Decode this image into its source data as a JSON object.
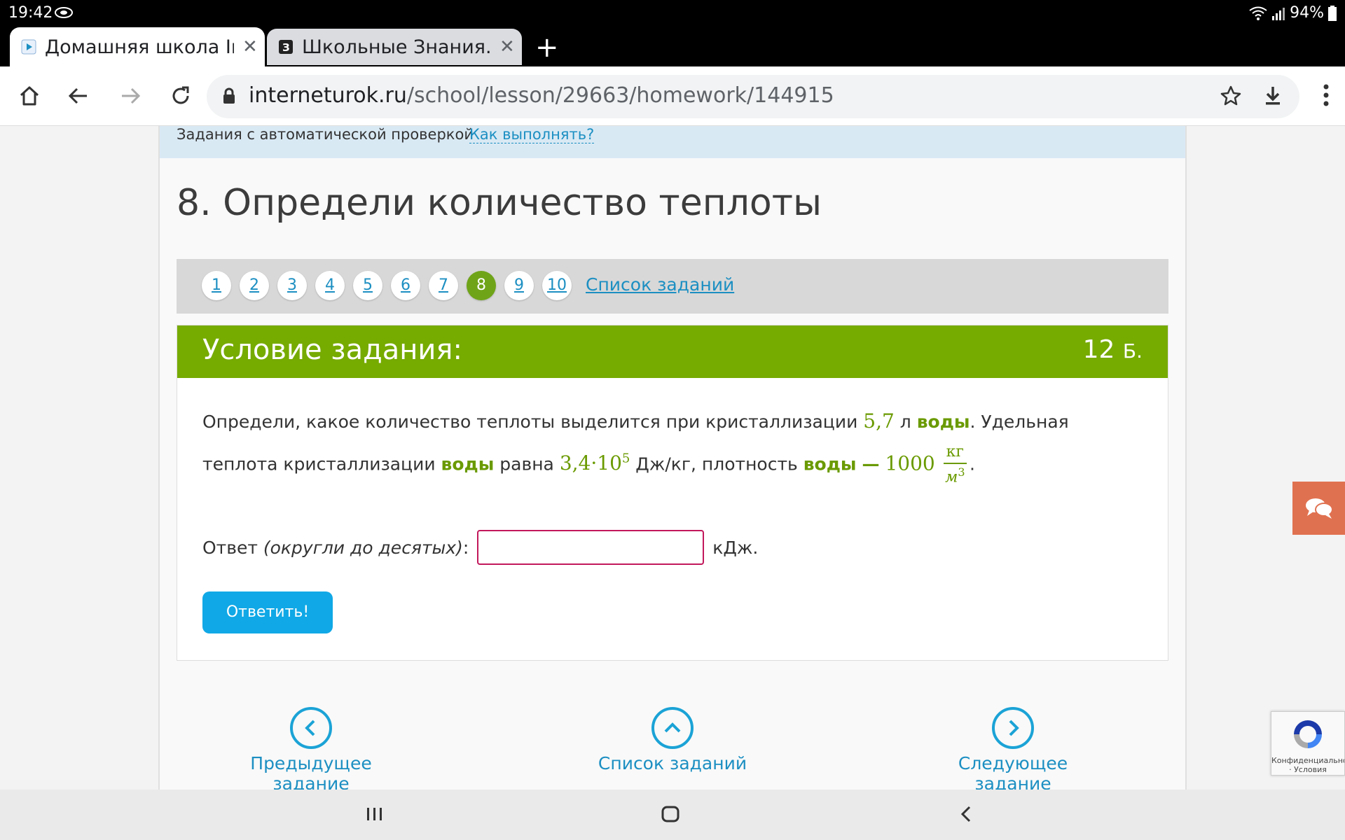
{
  "status": {
    "time": "19:42",
    "battery": "94%"
  },
  "tabs": [
    {
      "label": "Домашняя школа Int",
      "close": "✕"
    },
    {
      "label": "Школьные Знания.co",
      "close": "✕"
    }
  ],
  "new_tab": "+",
  "address": {
    "host": "interneturok.ru",
    "path": "/school/lesson/29663/homework/144915"
  },
  "notice": {
    "text": "Задания с автоматической проверкой",
    "link": "Как выполнять?"
  },
  "page_title": "8. Определи количество теплоты",
  "pager": {
    "pages": [
      "1",
      "2",
      "3",
      "4",
      "5",
      "6",
      "7",
      "8",
      "9",
      "10"
    ],
    "active": "8",
    "list_link": "Список заданий"
  },
  "task": {
    "header": "Условие задания:",
    "points_value": "12",
    "points_unit": "Б.",
    "problem": {
      "p1": "Определи, какое количество теплоты выделится при кристаллизации",
      "v1": "5,7",
      "u1": "л",
      "w1": "воды",
      "p2": ". Удельная теплота кристаллизации",
      "w2": "воды",
      "p3": "равна",
      "v2_base": "3,4·10",
      "v2_exp": "5",
      "p4": "Дж/кг, плотность",
      "w3": "воды",
      "dash": "—",
      "v3": "1000",
      "frac_num": "кг",
      "frac_den": "м",
      "frac_den_exp": "3",
      "end": "."
    },
    "answer": {
      "label": "Ответ",
      "hint": "(округли до десятых)",
      "colon": ":",
      "value": "",
      "unit": "кДж."
    },
    "submit": "Ответить!"
  },
  "bottom_nav": {
    "prev": "Предыдущее задание",
    "list": "Список заданий",
    "next": "Следующее задание"
  },
  "recaptcha": {
    "text": "Конфиденциальность · Условия"
  },
  "colors": {
    "green": "#76ab00",
    "blue": "#10a8e6",
    "link": "#1c8fc2",
    "chat": "#e07150"
  }
}
